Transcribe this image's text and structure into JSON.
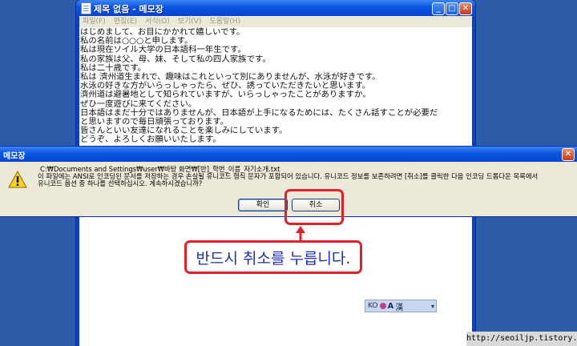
{
  "notepad": {
    "title": "제목 없음 - 메모장",
    "menu": [
      "파일(F)",
      "편집(E)",
      "서식(O)",
      "보기(V)",
      "도움말(H)"
    ],
    "lines": [
      "はじめまして、お目にかかれて嬉しいです。",
      "私の名前は○○○と申します。",
      "私は現在ソイル大学の日本語科一年生です。",
      "私の家族は父、母、妹、そして私の四人家族です。",
      "私は二十歳です。",
      "私は 濟州道生まれで、趣味はこれといって別にありませんが、水泳が好きです。",
      "水泳の好きな方がいらっしゃったら、ぜひ、誘っていただきたいと思います。",
      "濟州道は避暑地として知られていますが、いらっしゃったことがありますか。",
      "ぜひ一度遊びに来てください。",
      "日本語はまだ十分ではありませんが、日本語が上手になるためには、たくさん話すことが必要だ",
      "と思いますので毎日頑張っております。",
      "皆さんといい友達になれることを楽しみにしています。",
      "どうぞ、よろしくお願いいたします。"
    ],
    "ime": {
      "lang": "KO",
      "mode_a": "A",
      "mode_han": "漢"
    }
  },
  "dialog": {
    "title": "메모장",
    "icon": "warning-icon",
    "message_lines": [
      "C:₩Documents and Settings₩user₩바탕 화면₩[반]_학번_이름_자기소개.txt",
      "이 파일에는 ANSI로 인코딩된 문서를 저장하는 경우 손실될 유니코드 형식 문자가 포함되어 있습니다. 유니코드 정보를 보존하려면 [취소]를 클릭한 다음 인코딩 드롭다운 목록에서",
      "유니코드 옵션 중 하나를 선택하십시오. 계속하시겠습니까?"
    ],
    "ok_label": "확인",
    "cancel_label": "취소"
  },
  "annotation": {
    "callout_text": "반드시 취소를 누릅니다.",
    "color": "#e0202a",
    "text_color": "#1b2fb0"
  },
  "watermark": "http://seoiljp.tistory.com"
}
